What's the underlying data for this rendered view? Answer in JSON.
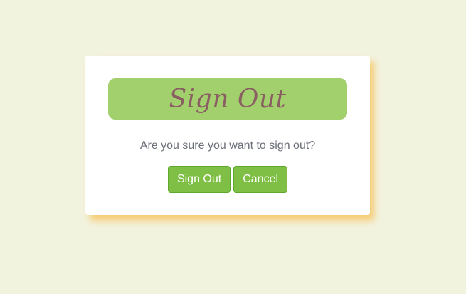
{
  "dialog": {
    "title": "Sign Out",
    "message": "Are you sure you want to sign out?",
    "confirm_label": "Sign Out",
    "cancel_label": "Cancel"
  },
  "colors": {
    "background": "#f2f3df",
    "banner": "#a2d06d",
    "title_text": "#8a5f62",
    "button": "#80bf45",
    "shadow": "#f7c460"
  }
}
